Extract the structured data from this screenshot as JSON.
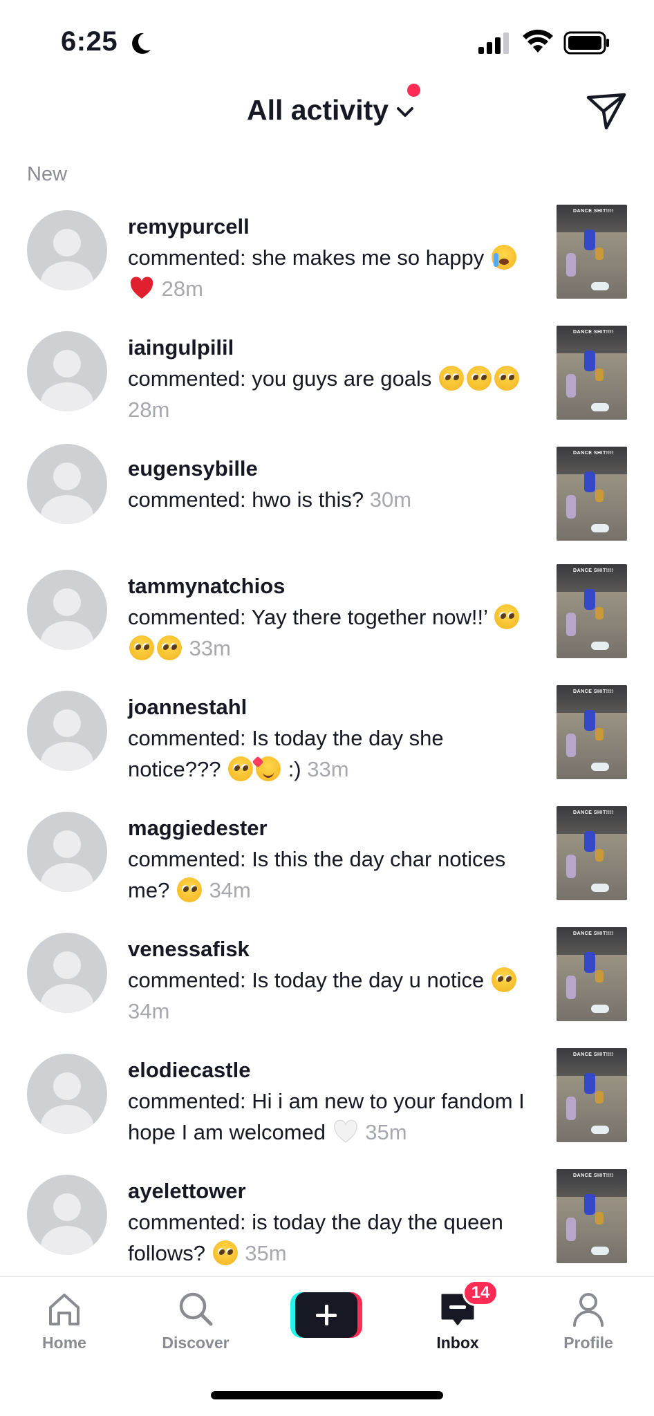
{
  "status_bar": {
    "time": "6:25"
  },
  "header": {
    "title": "All activity",
    "section_label": "New"
  },
  "activities": [
    {
      "username": "remypurcell",
      "comment": "commented: she makes me so happy",
      "emojis": [
        "crying",
        "heart"
      ],
      "time": "28m"
    },
    {
      "username": "iaingulpilil",
      "comment": "commented: you guys are goals",
      "emojis": [
        "pleading",
        "pleading",
        "pleading"
      ],
      "time": "28m"
    },
    {
      "username": "eugensybille",
      "comment": "commented: hwo is this?",
      "emojis": [],
      "time": "30m"
    },
    {
      "username": "tammynatchios",
      "comment": "commented: Yay there together now!!’",
      "emojis": [
        "pleading",
        "pleading",
        "pleading"
      ],
      "time": "33m"
    },
    {
      "username": "joannestahl",
      "comment": "commented: Is today the day she notice???",
      "emojis": [
        "pleading",
        "smiling-hearts"
      ],
      "suffix": " :)",
      "time": "33m"
    },
    {
      "username": "maggiedester",
      "comment": "commented: Is this the day char notices me?",
      "emojis": [
        "pleading"
      ],
      "time": "34m"
    },
    {
      "username": "venessafisk",
      "comment": "commented: Is today the day u notice",
      "emojis": [
        "pleading"
      ],
      "time": "34m"
    },
    {
      "username": "elodiecastle",
      "comment": "commented: Hi i am new to your fandom I hope I am welcomed",
      "emojis": [
        "white-heart"
      ],
      "time": "35m"
    },
    {
      "username": "ayelettower",
      "comment": "commented: is today the day the queen follows?",
      "emojis": [
        "pleading"
      ],
      "time": "35m"
    }
  ],
  "thumbnail_text": "DANCE SHIT!!!!",
  "tab_bar": {
    "home": "Home",
    "discover": "Discover",
    "inbox": "Inbox",
    "profile": "Profile",
    "inbox_badge": "14"
  },
  "colors": {
    "accent": "#fe2c55",
    "cyan": "#25f4ee",
    "text": "#161823",
    "muted": "#a7a8ad"
  }
}
